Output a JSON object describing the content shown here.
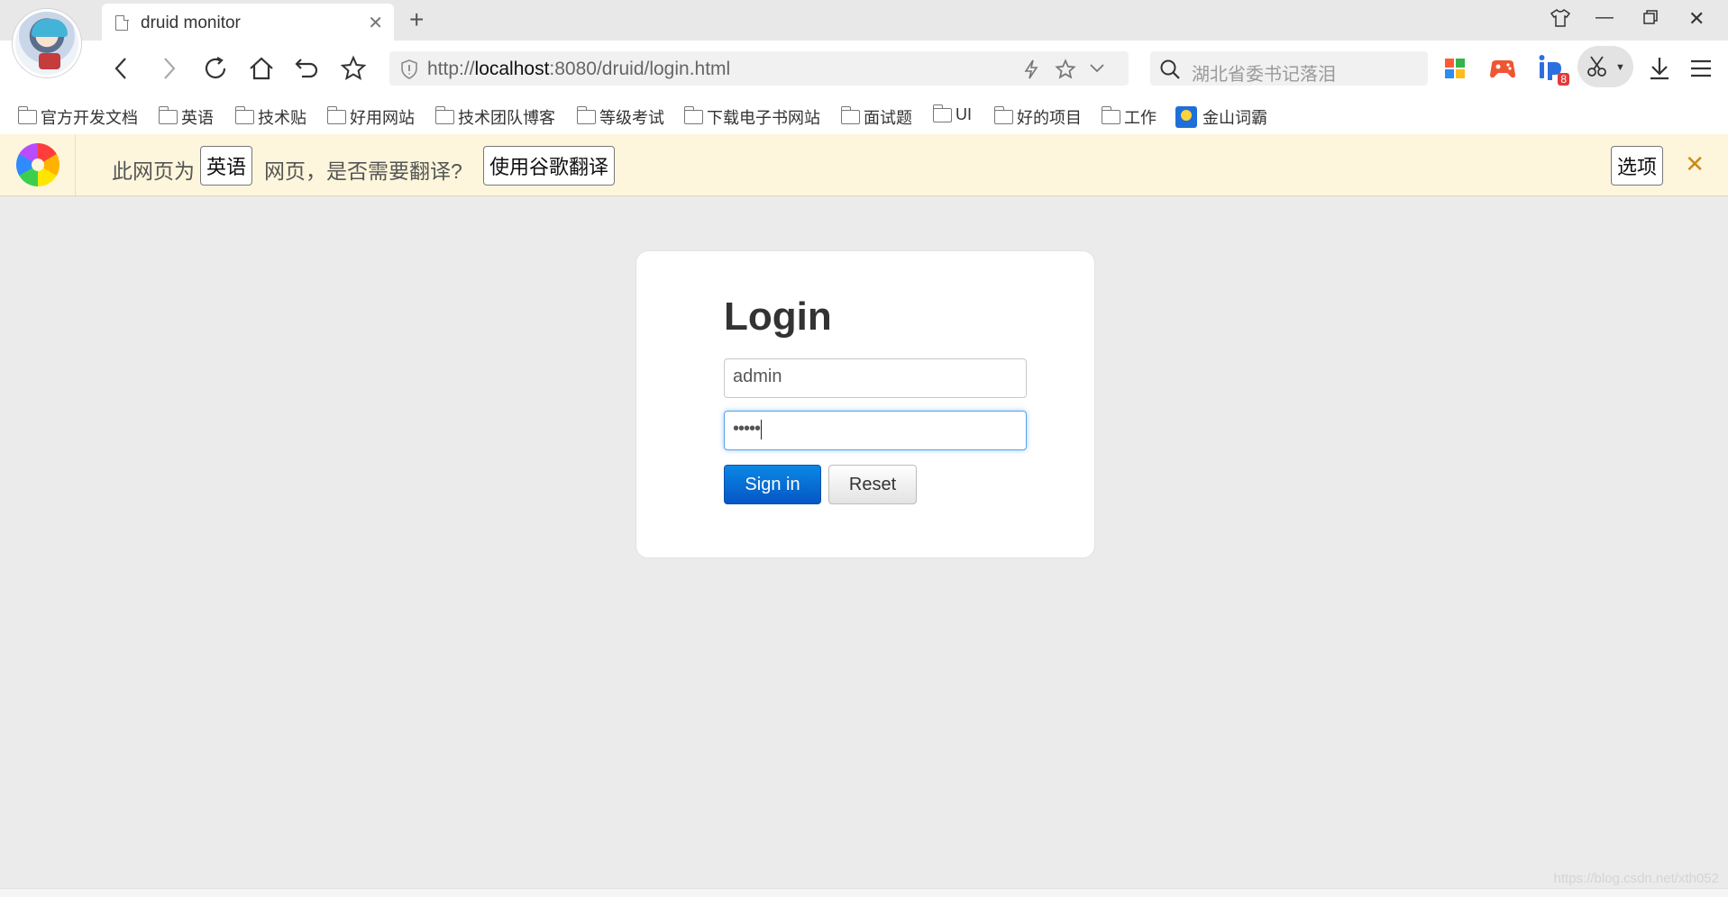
{
  "tab": {
    "title": "druid monitor"
  },
  "address": {
    "scheme": "http://",
    "host": "localhost",
    "rest": ":8080/druid/login.html"
  },
  "search": {
    "placeholder": "湖北省委书记落泪"
  },
  "extensions": {
    "badge_count": "8"
  },
  "bookmarks": [
    {
      "label": "官方开发文档",
      "icon": "folder-icon"
    },
    {
      "label": "英语",
      "icon": "folder-icon"
    },
    {
      "label": "技术贴",
      "icon": "folder-icon"
    },
    {
      "label": "好用网站",
      "icon": "folder-icon"
    },
    {
      "label": "技术团队博客",
      "icon": "folder-icon"
    },
    {
      "label": "等级考试",
      "icon": "folder-icon"
    },
    {
      "label": "下载电子书网站",
      "icon": "folder-icon"
    },
    {
      "label": "面试题",
      "icon": "folder-icon"
    },
    {
      "label": "UI",
      "icon": "folder-icon"
    },
    {
      "label": "好的项目",
      "icon": "folder-icon"
    },
    {
      "label": "工作",
      "icon": "folder-icon"
    },
    {
      "label": "金山词霸",
      "icon": "kingsoft-icon"
    }
  ],
  "translate": {
    "prefix": "此网页为",
    "language": "英语",
    "question": "网页，是否需要翻译?",
    "translate_button": "使用谷歌翻译",
    "options_button": "选项"
  },
  "login": {
    "heading": "Login",
    "username_value": "admin",
    "password_value": "•••••",
    "signin_label": "Sign in",
    "reset_label": "Reset"
  },
  "watermark": "https://blog.csdn.net/xth052",
  "colors": {
    "primary_button": "#0668d6",
    "translate_bar": "#fdf6dc"
  }
}
